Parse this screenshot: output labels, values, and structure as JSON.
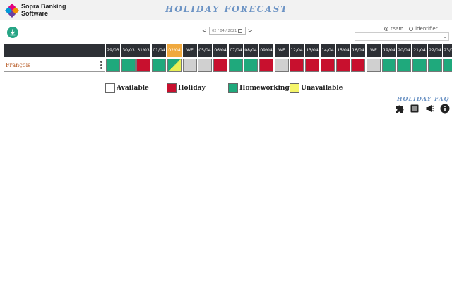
{
  "header": {
    "logo_line1": "Sopra Banking",
    "logo_line2": "Software",
    "app_title": "HOLIDAY FORECAST"
  },
  "nav": {
    "prev": "<",
    "next": ">",
    "date_value": "02 / 04 / 2021"
  },
  "filters": {
    "option_team": "team",
    "option_identifier": "identifier",
    "selected": "team"
  },
  "days": [
    {
      "label": "29/03",
      "status": "homeworking"
    },
    {
      "label": "30/03",
      "status": "homeworking"
    },
    {
      "label": "31/03",
      "status": "holiday"
    },
    {
      "label": "01/04",
      "status": "homeworking"
    },
    {
      "label": "02/04",
      "status": "split",
      "today": true
    },
    {
      "label": "WE",
      "status": "weekend"
    },
    {
      "label": "05/04",
      "status": "weekend"
    },
    {
      "label": "06/04",
      "status": "holiday"
    },
    {
      "label": "07/04",
      "status": "homeworking"
    },
    {
      "label": "08/04",
      "status": "homeworking"
    },
    {
      "label": "09/04",
      "status": "holiday"
    },
    {
      "label": "WE",
      "status": "weekend"
    },
    {
      "label": "12/04",
      "status": "holiday"
    },
    {
      "label": "13/04",
      "status": "holiday"
    },
    {
      "label": "14/04",
      "status": "holiday"
    },
    {
      "label": "15/04",
      "status": "holiday"
    },
    {
      "label": "16/04",
      "status": "holiday"
    },
    {
      "label": "WE",
      "status": "weekend"
    },
    {
      "label": "19/04",
      "status": "homeworking"
    },
    {
      "label": "20/04",
      "status": "homeworking"
    },
    {
      "label": "21/04",
      "status": "homeworking"
    },
    {
      "label": "22/04",
      "status": "homeworking"
    },
    {
      "label": "23/04",
      "status": "homeworking"
    }
  ],
  "employee": {
    "name": "François"
  },
  "legend": [
    {
      "label": "Available",
      "color": "#ffffff"
    },
    {
      "label": "Holiday",
      "color": "#c8102e"
    },
    {
      "label": "Homeworking",
      "color": "#1fa97c"
    },
    {
      "label": "Unavailable",
      "color": "#f5f56a"
    }
  ],
  "colors": {
    "holiday": "#c8102e",
    "homeworking": "#1fa97c",
    "weekend": "#d0d0d0",
    "unavailable": "#e8ef55",
    "today": "#f0a93e"
  },
  "links": {
    "faq": "HOLIDAY FAQ"
  },
  "toolbar_icons": [
    "puzzle-icon",
    "list-icon",
    "megaphone-icon",
    "info-icon"
  ]
}
